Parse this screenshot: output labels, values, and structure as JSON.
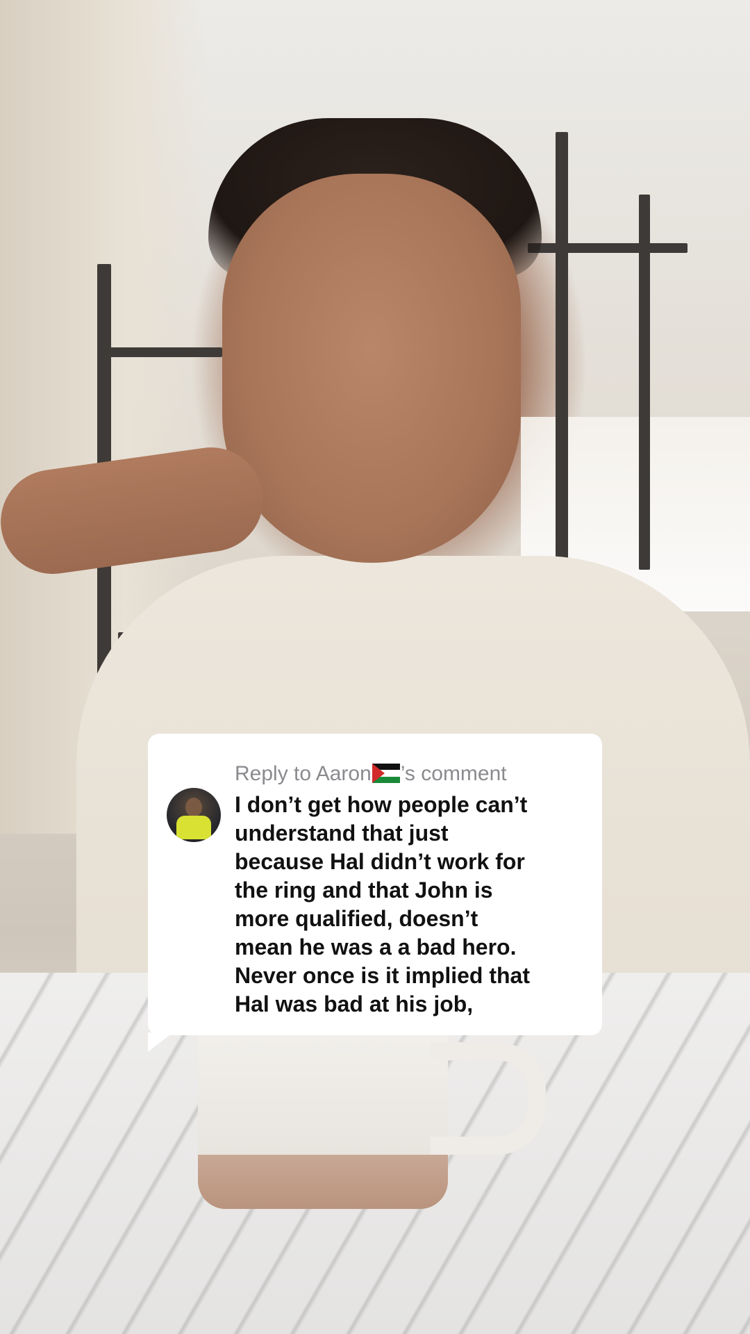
{
  "reply_card": {
    "header_prefix": "Reply to Aaron",
    "header_flag_icon": "palestine-flag-icon",
    "header_suffix": "’s comment",
    "comment_lines": [
      "I don’t get how people can’t",
      "understand that just",
      "because Hal didn’t work for",
      "the ring and that John is",
      "more qualified, doesn’t",
      "mean he was a a bad hero.",
      "Never once is it implied that",
      "Hal was bad at his job,"
    ],
    "avatar_icon": "commenter-avatar",
    "colors": {
      "bubble_bg": "#ffffff",
      "header_text": "#8a8a8f",
      "body_text": "#111111"
    }
  }
}
